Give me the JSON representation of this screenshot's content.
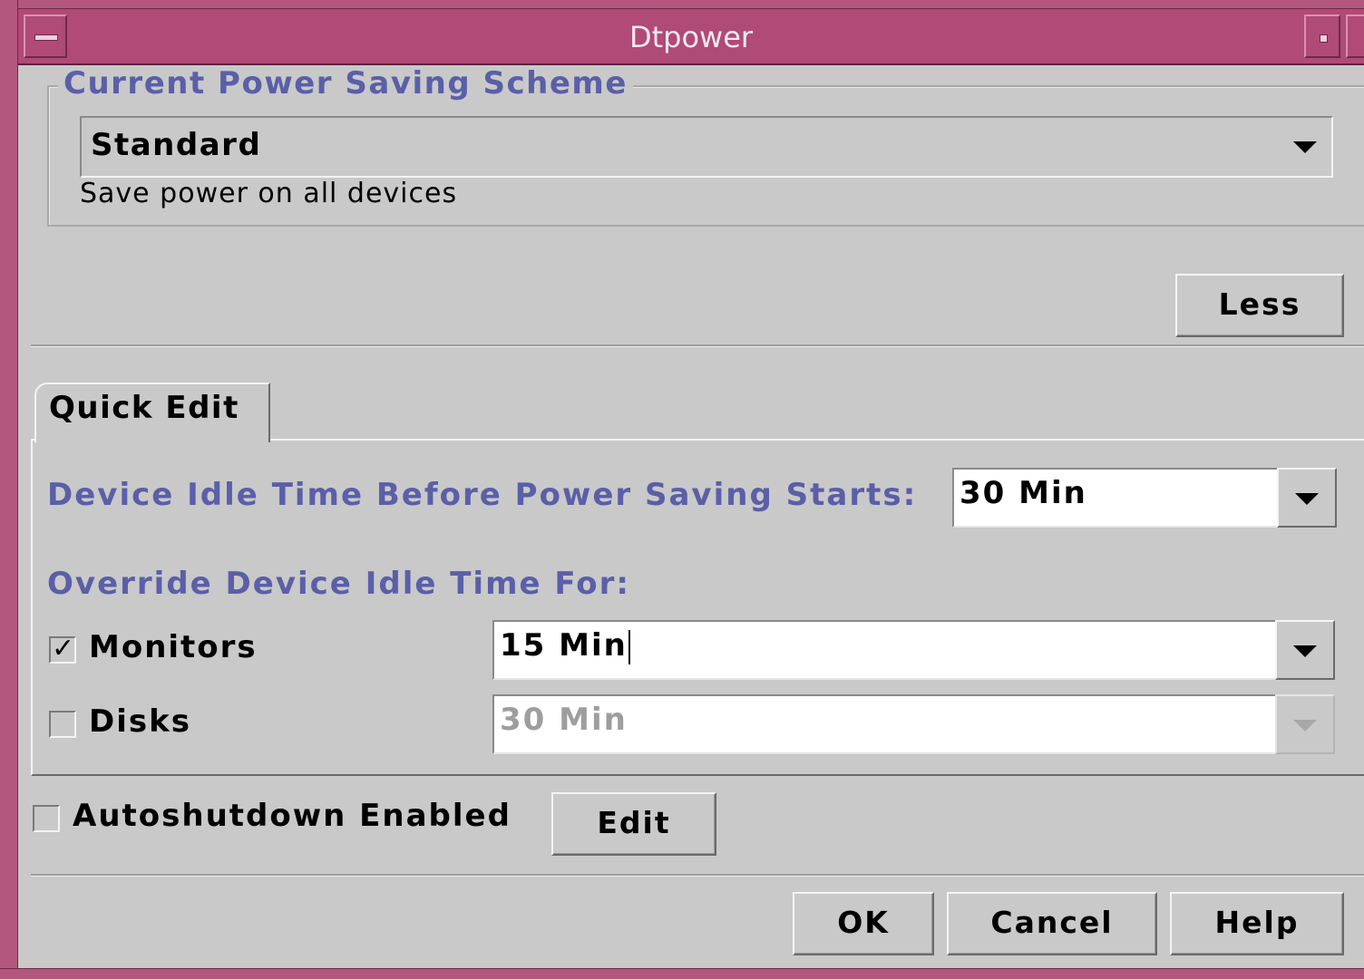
{
  "window": {
    "title": "Dtpower"
  },
  "scheme": {
    "group_label": "Current Power Saving Scheme",
    "selected": "Standard",
    "description": "Save power on all devices"
  },
  "less_button": "Less",
  "tabs": [
    {
      "label": "Quick Edit",
      "selected": true
    }
  ],
  "quick_edit": {
    "idle_label": "Device Idle Time Before Power Saving Starts:",
    "idle_value": "30 Min",
    "override_label": "Override Device Idle Time For:",
    "monitors": {
      "label": "Monitors",
      "checked": true,
      "value": "15 Min",
      "enabled": true
    },
    "disks": {
      "label": "Disks",
      "checked": false,
      "value": "30 Min",
      "enabled": false
    }
  },
  "autoshutdown": {
    "label": "Autoshutdown Enabled",
    "checked": false,
    "edit_label": "Edit"
  },
  "footer": {
    "ok_label": "OK",
    "cancel_label": "Cancel",
    "help_label": "Help"
  },
  "colors": {
    "titlebar": "#b04a77",
    "accent_label": "#5a5fa8",
    "background": "#c9c9c9"
  }
}
